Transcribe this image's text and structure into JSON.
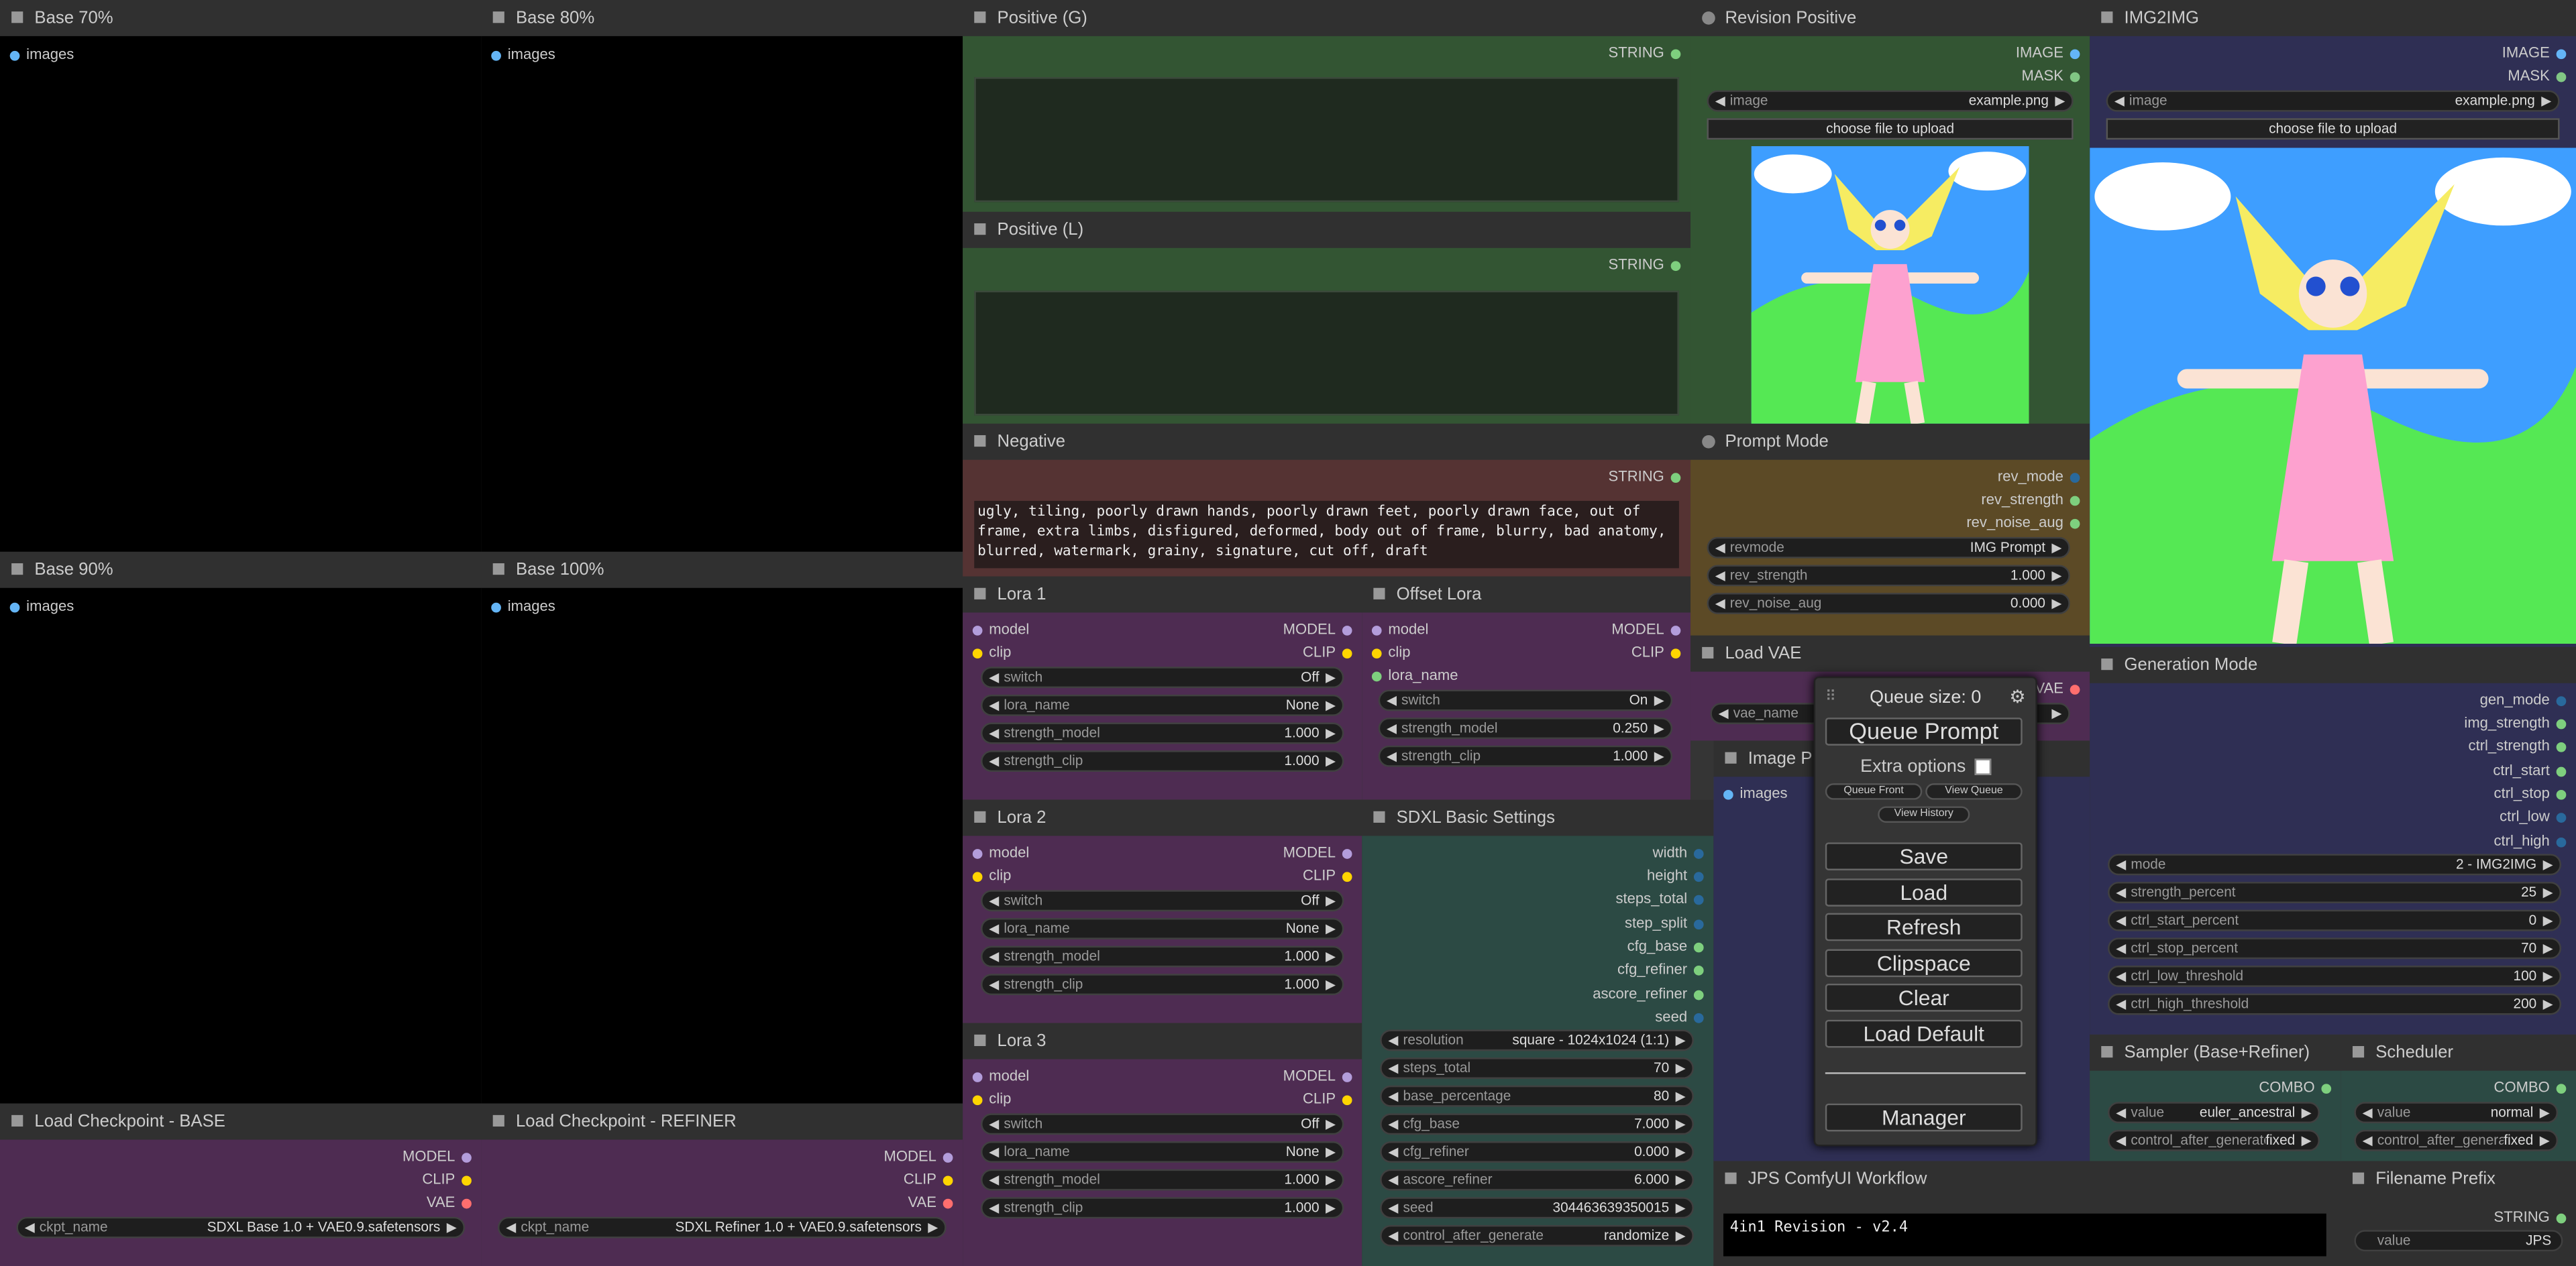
{
  "pin_colors": {
    "image": "#64b5f6",
    "model": "#b39ddb",
    "clip": "#ffd500",
    "vae": "#ff6e6e",
    "string": "#7ecf7e",
    "int": "#29699c",
    "float": "#7ecf7e",
    "combo": "#7ecf7e",
    "mask": "#81c784",
    "lora": "#7ecf7e"
  },
  "base70": {
    "title": "Base 70%",
    "input": "images"
  },
  "base80": {
    "title": "Base 80%",
    "input": "images"
  },
  "base90": {
    "title": "Base 90%",
    "input": "images"
  },
  "base100": {
    "title": "Base 100%",
    "input": "images"
  },
  "ckpt_base": {
    "title": "Load Checkpoint - BASE",
    "out_model": "MODEL",
    "out_clip": "CLIP",
    "out_vae": "VAE",
    "w_label": "ckpt_name",
    "w_value": "SDXL Base 1.0 + VAE0.9.safetensors"
  },
  "ckpt_ref": {
    "title": "Load Checkpoint - REFINER",
    "out_model": "MODEL",
    "out_clip": "CLIP",
    "out_vae": "VAE",
    "w_label": "ckpt_name",
    "w_value": "SDXL Refiner 1.0 + VAE0.9.safetensors"
  },
  "pos_g": {
    "title": "Positive (G)",
    "out": "STRING",
    "text": ""
  },
  "pos_l": {
    "title": "Positive (L)",
    "out": "STRING",
    "text": ""
  },
  "negative": {
    "title": "Negative",
    "out": "STRING",
    "text": "ugly, tiling, poorly drawn hands, poorly drawn feet, poorly drawn face, out of frame, extra limbs, disfigured, deformed, body out of frame, blurry, bad anatomy, blurred, watermark, grainy, signature, cut off, draft"
  },
  "lora1": {
    "title": "Lora 1",
    "in_model": "model",
    "in_clip": "clip",
    "out_model": "MODEL",
    "out_clip": "CLIP",
    "switch": "Off",
    "lora_name": "None",
    "strength_model": "1.000",
    "strength_clip": "1.000"
  },
  "lora2": {
    "title": "Lora 2",
    "in_model": "model",
    "in_clip": "clip",
    "out_model": "MODEL",
    "out_clip": "CLIP",
    "switch": "Off",
    "lora_name": "None",
    "strength_model": "1.000",
    "strength_clip": "1.000"
  },
  "lora3": {
    "title": "Lora 3",
    "in_model": "model",
    "in_clip": "clip",
    "out_model": "MODEL",
    "out_clip": "CLIP",
    "switch": "Off",
    "lora_name": "None",
    "strength_model": "1.000",
    "strength_clip": "1.000"
  },
  "offset": {
    "title": "Offset Lora",
    "in_model": "model",
    "in_clip": "clip",
    "in_lora": "lora_name",
    "out_model": "MODEL",
    "out_clip": "CLIP",
    "switch": "On",
    "strength_model": "0.250",
    "strength_clip": "1.000"
  },
  "labels": {
    "switch": "switch",
    "lora_name": "lora_name",
    "strength_model": "strength_model",
    "strength_clip": "strength_clip"
  },
  "sdxl": {
    "title": "SDXL Basic Settings",
    "outs": [
      "width",
      "height",
      "steps_total",
      "step_split",
      "cfg_base",
      "cfg_refiner",
      "ascore_refiner",
      "seed"
    ],
    "widgets": [
      {
        "label": "resolution",
        "value": "square - 1024x1024 (1:1)"
      },
      {
        "label": "steps_total",
        "value": "70"
      },
      {
        "label": "base_percentage",
        "value": "80"
      },
      {
        "label": "cfg_base",
        "value": "7.000"
      },
      {
        "label": "cfg_refiner",
        "value": "0.000"
      },
      {
        "label": "ascore_refiner",
        "value": "6.000"
      },
      {
        "label": "seed",
        "value": "304463639350015"
      },
      {
        "label": "control_after_generate",
        "value": "randomize"
      }
    ]
  },
  "rev_pos": {
    "title": "Revision Positive",
    "out_image": "IMAGE",
    "out_mask": "MASK",
    "w_label": "image",
    "w_value": "example.png",
    "upload": "choose file to upload"
  },
  "prompt_mode": {
    "title": "Prompt Mode",
    "outs": [
      "rev_mode",
      "rev_strength",
      "rev_noise_aug"
    ],
    "widgets": [
      {
        "label": "revmode",
        "value": "IMG Prompt"
      },
      {
        "label": "rev_strength",
        "value": "1.000"
      },
      {
        "label": "rev_noise_aug",
        "value": "0.000"
      }
    ]
  },
  "load_vae": {
    "title": "Load VAE",
    "out": "VAE",
    "w_label": "vae_name"
  },
  "image_preview": {
    "title": "Image P",
    "input": "images"
  },
  "img2img": {
    "title": "IMG2IMG",
    "out_image": "IMAGE",
    "out_mask": "MASK",
    "w_label": "image",
    "w_value": "example.png",
    "upload": "choose file to upload"
  },
  "gen_mode": {
    "title": "Generation Mode",
    "outs": [
      "gen_mode",
      "img_strength",
      "ctrl_strength",
      "ctrl_start",
      "ctrl_stop",
      "ctrl_low",
      "ctrl_high"
    ],
    "widgets": [
      {
        "label": "mode",
        "value": "2 - IMG2IMG"
      },
      {
        "label": "strength_percent",
        "value": "25"
      },
      {
        "label": "ctrl_start_percent",
        "value": "0"
      },
      {
        "label": "ctrl_stop_percent",
        "value": "70"
      },
      {
        "label": "ctrl_low_threshold",
        "value": "100"
      },
      {
        "label": "ctrl_high_threshold",
        "value": "200"
      }
    ]
  },
  "sampler": {
    "title": "Sampler (Base+Refiner)",
    "out": "COMBO",
    "w1_label": "value",
    "w1_value": "euler_ancestral",
    "w2_label": "control_after_generate",
    "w2_value": "fixed"
  },
  "scheduler": {
    "title": "Scheduler",
    "out": "COMBO",
    "w1_label": "value",
    "w1_value": "normal",
    "w2_label": "control_after_generate",
    "w2_value": "fixed"
  },
  "workflow": {
    "title": "JPS ComfyUI Workflow",
    "text": "4in1 Revision - v2.4"
  },
  "filename": {
    "title": "Filename Prefix",
    "out": "STRING",
    "w_label": "value",
    "w_value": "JPS"
  },
  "menu": {
    "queue_size": "Queue size: 0",
    "queue_prompt": "Queue Prompt",
    "extra_options": "Extra options",
    "queue_front": "Queue Front",
    "view_queue": "View Queue",
    "view_history": "View History",
    "save": "Save",
    "load": "Load",
    "refresh": "Refresh",
    "clipspace": "Clipspace",
    "clear": "Clear",
    "load_default": "Load Default",
    "manager": "Manager"
  }
}
